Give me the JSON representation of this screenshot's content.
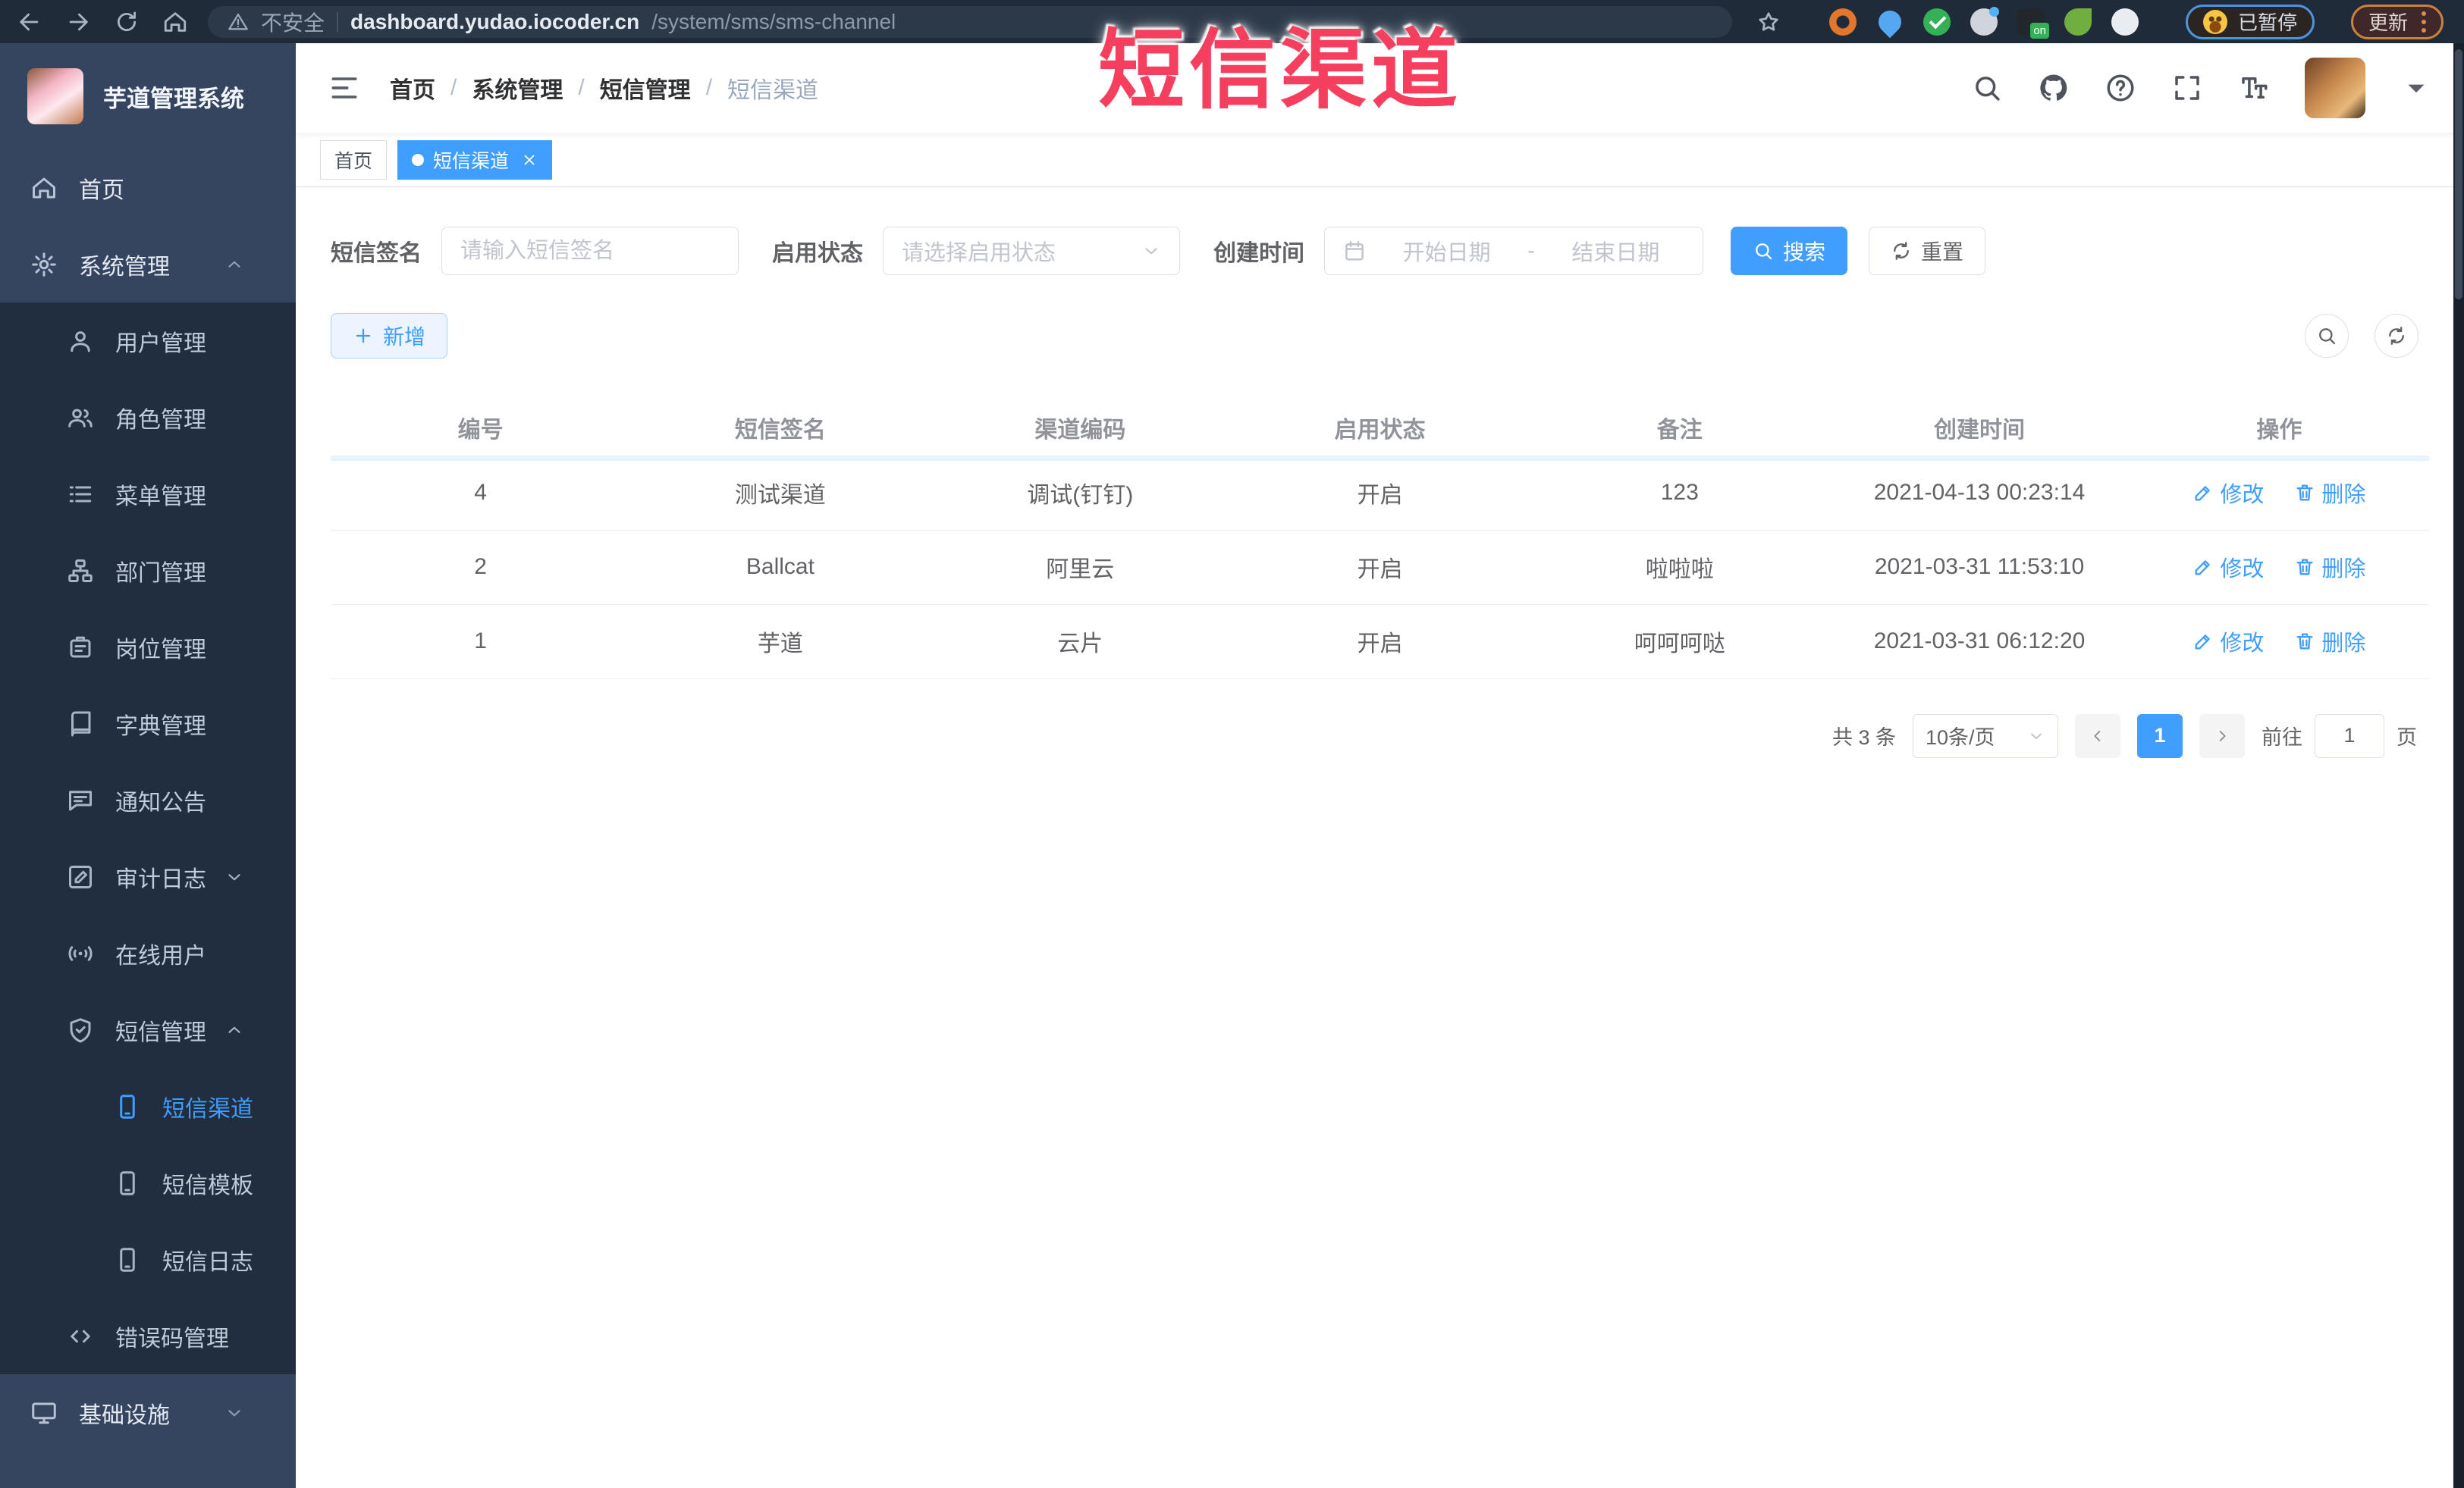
{
  "browser": {
    "nav_icons": [
      "back-icon",
      "forward-icon",
      "reload-icon",
      "home-icon"
    ],
    "security_label": "不安全",
    "url_domain": "dashboard.yudao.iocoder.cn",
    "url_path": "/system/sms/sms-channel",
    "bookmark_icon": "star-icon",
    "extension_icons": [
      "orange-ring-icon",
      "location-pin-icon",
      "green-check-icon",
      "people-icon",
      "on-badge-icon",
      "green-sprout-icon",
      "white-bird-icon"
    ],
    "on_badge": "on",
    "paused_badge": "已暂停",
    "update_button": "更新"
  },
  "overlay_title": "短信渠道",
  "sidebar": {
    "app_title": "芋道管理系统",
    "items": [
      {
        "label": "首页",
        "icon": "home-icon",
        "level": 1
      },
      {
        "label": "系统管理",
        "icon": "gear-icon",
        "level": 1,
        "arrow": "up"
      },
      {
        "label": "用户管理",
        "icon": "user-icon",
        "level": 2
      },
      {
        "label": "角色管理",
        "icon": "people-icon",
        "level": 2
      },
      {
        "label": "菜单管理",
        "icon": "list-icon",
        "level": 2
      },
      {
        "label": "部门管理",
        "icon": "org-tree-icon",
        "level": 2
      },
      {
        "label": "岗位管理",
        "icon": "badge-icon",
        "level": 2
      },
      {
        "label": "字典管理",
        "icon": "book-icon",
        "level": 2
      },
      {
        "label": "通知公告",
        "icon": "announcement-icon",
        "level": 2
      },
      {
        "label": "审计日志",
        "icon": "log-icon",
        "level": 2,
        "arrow": "down"
      },
      {
        "label": "在线用户",
        "icon": "signal-icon",
        "level": 2
      },
      {
        "label": "短信管理",
        "icon": "shield-message-icon",
        "level": 2,
        "arrow": "up"
      },
      {
        "label": "短信渠道",
        "icon": "phone-icon",
        "level": 3,
        "active": true
      },
      {
        "label": "短信模板",
        "icon": "phone-icon",
        "level": 3
      },
      {
        "label": "短信日志",
        "icon": "phone-icon",
        "level": 3
      },
      {
        "label": "错误码管理",
        "icon": "code-icon",
        "level": 2
      },
      {
        "label": "基础设施",
        "icon": "monitor-icon",
        "level": 1,
        "arrow": "down"
      }
    ]
  },
  "header": {
    "breadcrumb": [
      "首页",
      "系统管理",
      "短信管理",
      "短信渠道"
    ],
    "breadcrumb_separator": "/",
    "icons": [
      "search-icon",
      "github-icon",
      "help-icon",
      "fullscreen-icon",
      "font-size-icon",
      "avatar",
      "caret-down-icon"
    ]
  },
  "tags": [
    {
      "label": "首页",
      "active": false,
      "closable": false
    },
    {
      "label": "短信渠道",
      "active": true,
      "closable": true
    }
  ],
  "filters": {
    "sign_label": "短信签名",
    "sign_placeholder": "请输入短信签名",
    "status_label": "启用状态",
    "status_placeholder": "请选择启用状态",
    "date_label": "创建时间",
    "date_start": "开始日期",
    "date_separator": "-",
    "date_end": "结束日期",
    "search_button": "搜索",
    "reset_button": "重置"
  },
  "toolbar": {
    "add_button": "新增"
  },
  "table": {
    "columns": [
      "编号",
      "短信签名",
      "渠道编码",
      "启用状态",
      "备注",
      "创建时间",
      "操作"
    ],
    "rows": [
      {
        "id": "4",
        "signature": "测试渠道",
        "code": "调试(钉钉)",
        "status": "开启",
        "remark": "123",
        "create_time": "2021-04-13 00:23:14"
      },
      {
        "id": "2",
        "signature": "Ballcat",
        "code": "阿里云",
        "status": "开启",
        "remark": "啦啦啦",
        "create_time": "2021-03-31 11:53:10"
      },
      {
        "id": "1",
        "signature": "芋道",
        "code": "云片",
        "status": "开启",
        "remark": "呵呵呵哒",
        "create_time": "2021-03-31 06:12:20"
      }
    ],
    "edit_label": "修改",
    "delete_label": "删除"
  },
  "pagination": {
    "total": "共 3 条",
    "page_size": "10条/页",
    "current_page": "1",
    "goto_label": "前往",
    "goto_value": "1",
    "unit_label": "页"
  },
  "colors": {
    "primary": "#409EFF",
    "overlay": "#F63E5E",
    "sidebar_bg": "#36455F",
    "submenu_bg": "#202E40",
    "chrome_bg": "#202B3A"
  }
}
